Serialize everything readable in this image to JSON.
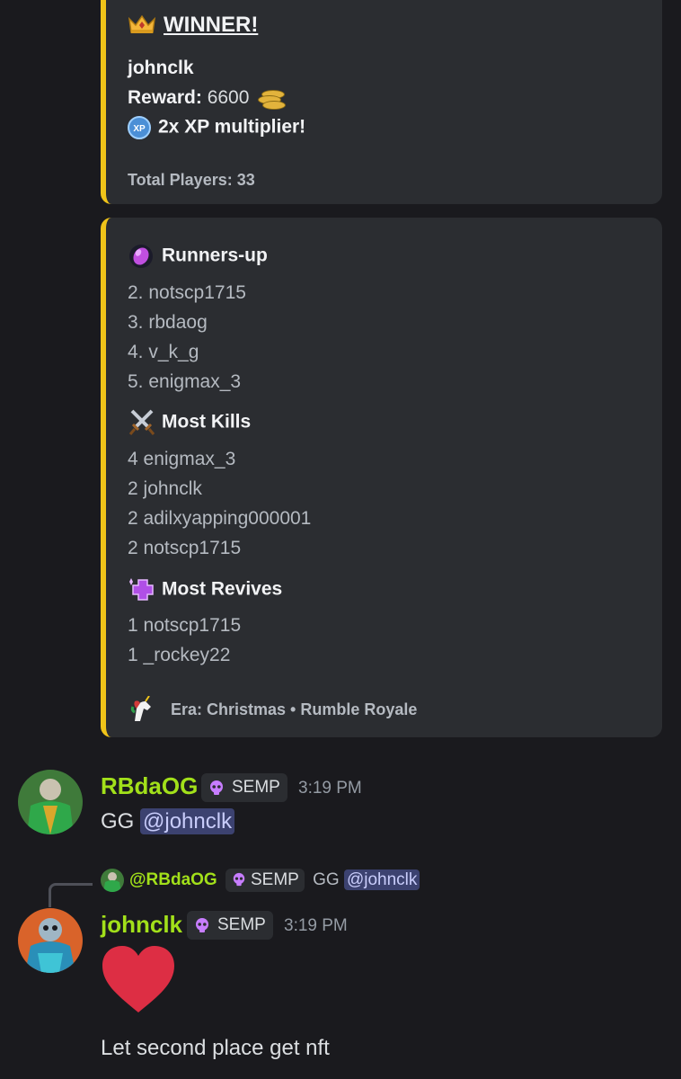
{
  "winner_embed": {
    "title": "WINNER!",
    "winner": "johnclk",
    "reward_label": "Reward:",
    "reward_value": "6600",
    "xp_badge": "XP",
    "multiplier": "2x XP multiplier!",
    "total_players": "Total Players: 33",
    "accent_color": "#f0c419"
  },
  "results_embed": {
    "runners_up_title": "Runners-up",
    "runners_up": [
      {
        "rank": "2.",
        "name": "notscp1715"
      },
      {
        "rank": "3.",
        "name": "rbdaog"
      },
      {
        "rank": "4.",
        "name": "v_k_g"
      },
      {
        "rank": "5.",
        "name": "enigmax_3"
      }
    ],
    "kills_title": "Most Kills",
    "kills": [
      {
        "count": "4",
        "name": "enigmax_3"
      },
      {
        "count": "2",
        "name": "johnclk"
      },
      {
        "count": "2",
        "name": "adilxyapping000001"
      },
      {
        "count": "2",
        "name": "notscp1715"
      }
    ],
    "revives_title": "Most Revives",
    "revives": [
      {
        "count": "1",
        "name": "notscp1715"
      },
      {
        "count": "1",
        "name": "_rockey22"
      }
    ],
    "footer": "Era: Christmas • Rumble Royale"
  },
  "messages": [
    {
      "username": "RBdaOG",
      "tag": "SEMP",
      "time": "3:19 PM",
      "text_prefix": "GG",
      "mention": "@johnclk"
    },
    {
      "reply_to_user": "@RBdaOG",
      "reply_tag": "SEMP",
      "reply_text": "GG",
      "reply_mention": "@johnclk",
      "username": "johnclk",
      "tag": "SEMP",
      "time": "3:19 PM",
      "emoji": "red-heart",
      "text": "Let second place get nft"
    }
  ],
  "colors": {
    "background": "#1a1a1e",
    "embed_bg": "#2b2d31",
    "username": "#a2e01a",
    "mention_bg": "#3c4270",
    "heart": "#dd2e44"
  }
}
